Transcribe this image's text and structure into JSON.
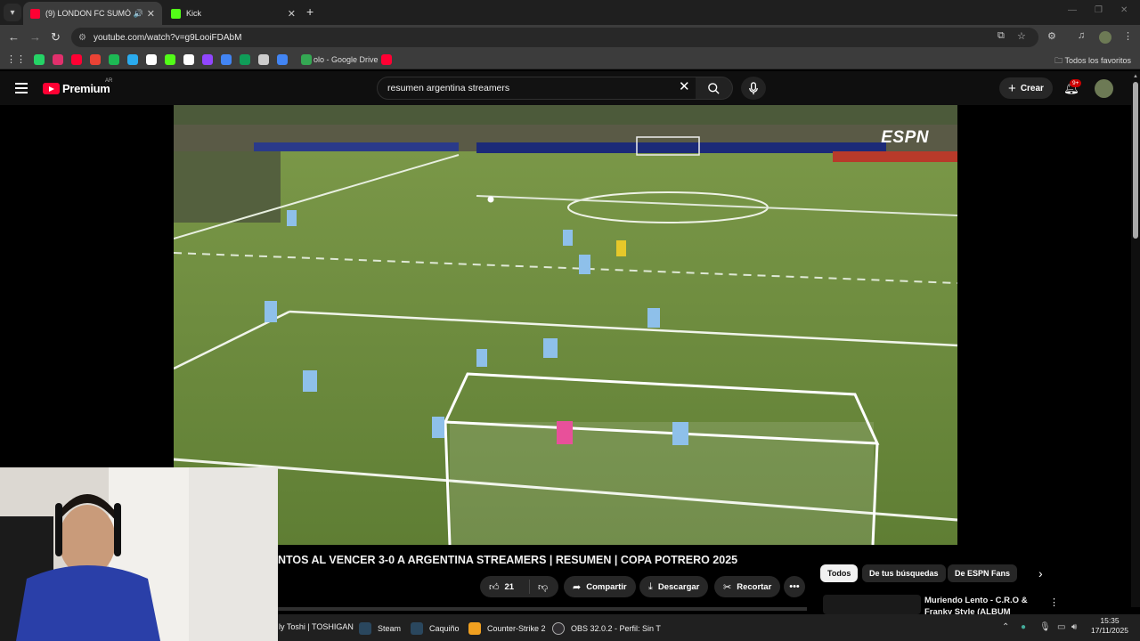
{
  "browser": {
    "tabs": [
      {
        "title": "(9) LONDON FC SUMÓ SU",
        "favicon_color": "#ff0033",
        "active": true
      },
      {
        "title": "Kick",
        "favicon_color": "#53fc18",
        "active": false
      }
    ],
    "url": "youtube.com/watch?v=g9LooiFDAbM",
    "bookmarks": [
      {
        "icon": "whatsapp-icon",
        "color": "#25d366"
      },
      {
        "icon": "instagram-icon",
        "color": "#e1306c"
      },
      {
        "icon": "youtube-icon",
        "color": "#ff0033"
      },
      {
        "icon": "gmail-icon",
        "color": "#ea4335"
      },
      {
        "icon": "spotify-icon",
        "color": "#1db954"
      },
      {
        "icon": "telegram-icon",
        "color": "#2aabee"
      },
      {
        "icon": "x-icon",
        "color": "#ffffff"
      },
      {
        "icon": "kick-icon",
        "color": "#53fc18"
      },
      {
        "icon": "tiktok-icon",
        "color": "#ffffff"
      },
      {
        "icon": "twitch-icon",
        "color": "#9146ff"
      },
      {
        "icon": "chrome-icon",
        "color": "#4285f4"
      },
      {
        "icon": "sheets-icon",
        "color": "#0f9d58"
      },
      {
        "icon": "chatgpt-icon",
        "color": "#cccccc"
      },
      {
        "icon": "translate-icon",
        "color": "#4285f4"
      }
    ],
    "bookmark_drive": "olo - Google Drive",
    "all_bookmarks": "Todos los favoritos"
  },
  "youtube": {
    "logo_text": "Premium",
    "country_code": "AR",
    "search_query": "resumen argentina streamers",
    "create_label": "Crear",
    "notifications_badge": "9+",
    "video_title": "NTOS AL VENCER 3-0 A ARGENTINA STREAMERS | RESUMEN | COPA POTRERO 2025",
    "watermark": "ESPN",
    "likes": "21",
    "share_label": "Compartir",
    "download_label": "Descargar",
    "clip_label": "Recortar",
    "chips": [
      "Todos",
      "De tus búsquedas",
      "De ESPN Fans"
    ],
    "recommended_title": "Muriendo Lento - C.R.O & Franky Style (ALBUM"
  },
  "taskbar": {
    "items": [
      {
        "label": "ly Toshi | TOSHIGAN",
        "color": "#7b3fe4"
      },
      {
        "label": "Steam",
        "color": "#1b2838"
      },
      {
        "label": "Caquiño",
        "color": "#1b2838"
      },
      {
        "label": "Counter-Strike 2",
        "color": "#f0a020"
      },
      {
        "label": "OBS 32.0.2 - Perfil: Sin T",
        "color": "#302e31"
      }
    ],
    "time": "15:35",
    "date": "17/11/2025"
  }
}
